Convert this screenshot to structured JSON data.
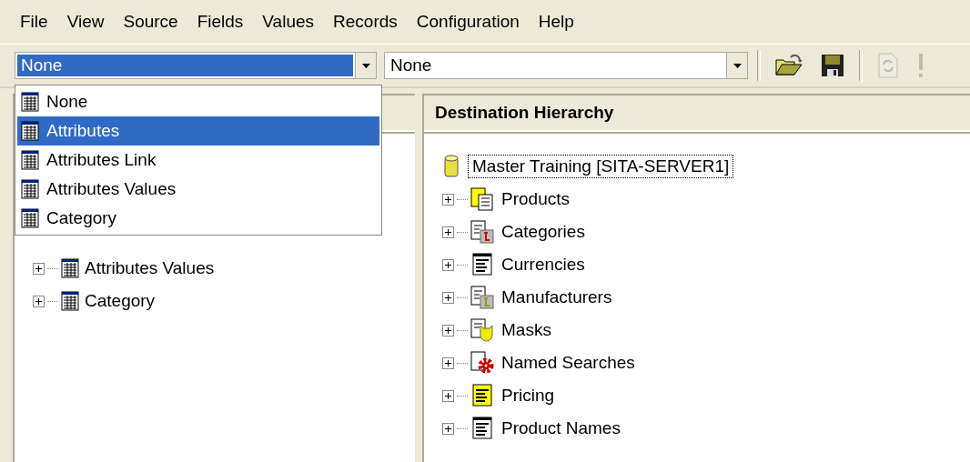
{
  "menu": [
    "File",
    "View",
    "Source",
    "Fields",
    "Values",
    "Records",
    "Configuration",
    "Help"
  ],
  "toolbar": {
    "source_combo": {
      "value": "None",
      "focused": true
    },
    "destination_combo": {
      "value": "None"
    },
    "buttons": [
      {
        "kind": "open",
        "disabled": false
      },
      {
        "kind": "save",
        "disabled": false
      },
      {
        "kind": "refresh",
        "disabled": true
      },
      {
        "kind": "execute",
        "disabled": true
      }
    ]
  },
  "dropdown": [
    {
      "label": "None",
      "selected": false
    },
    {
      "label": "Attributes",
      "selected": true
    },
    {
      "label": "Attributes Link",
      "selected": false
    },
    {
      "label": "Attributes Values",
      "selected": false
    },
    {
      "label": "Category",
      "selected": false
    }
  ],
  "source_tree": [
    {
      "label": "Attributes Values",
      "expanded": false
    },
    {
      "label": "Category",
      "expanded": false
    }
  ],
  "destination": {
    "title": "Destination Hierarchy",
    "root": "Master Training [SITA-SERVER1]",
    "items": [
      {
        "label": "Products",
        "kind": "products",
        "expanded": false
      },
      {
        "label": "Categories",
        "kind": "categories",
        "expanded": false
      },
      {
        "label": "Currencies",
        "kind": "plain",
        "expanded": false
      },
      {
        "label": "Manufacturers",
        "kind": "manufacturers",
        "expanded": false
      },
      {
        "label": "Masks",
        "kind": "masks",
        "expanded": false
      },
      {
        "label": "Named Searches",
        "kind": "searches",
        "expanded": false
      },
      {
        "label": "Pricing",
        "kind": "pricing",
        "expanded": false
      },
      {
        "label": "Product Names",
        "kind": "plain",
        "expanded": false
      }
    ]
  }
}
